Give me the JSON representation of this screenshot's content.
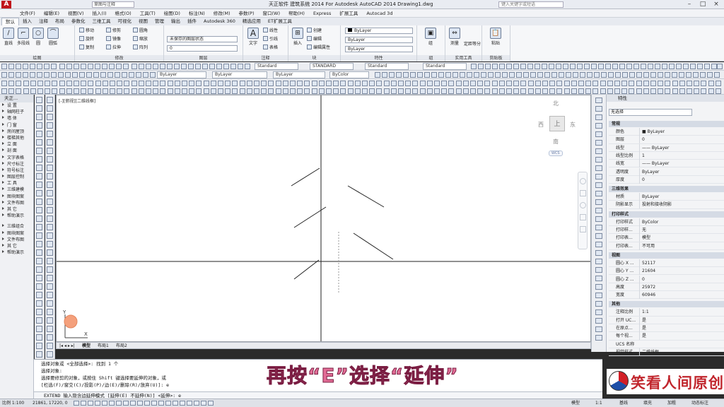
{
  "title_bar": {
    "workspace": "草图与注释",
    "title": "天正软件 建筑系统 2014  For Autodesk AutoCAD 2014    Drawing1.dwg",
    "search_placeholder": "键入关键字或短语"
  },
  "menu": [
    "文件(F)",
    "编辑(E)",
    "视图(V)",
    "插入(I)",
    "格式(O)",
    "工具(T)",
    "绘图(D)",
    "标注(N)",
    "修改(M)",
    "参数(P)",
    "窗口(W)",
    "帮助(H)",
    "Express",
    "扩展工具",
    "Autocad 3d"
  ],
  "ribbon_tabs": [
    "默认",
    "插入",
    "注释",
    "布局",
    "参数化",
    "三维工具",
    "可视化",
    "视图",
    "管理",
    "输出",
    "插件",
    "Autodesk 360",
    "精选应用",
    "ET扩展工具"
  ],
  "ribbon": {
    "draw_panel": {
      "label": "绘图",
      "tools": [
        "直线",
        "多段线",
        "圆",
        "圆弧"
      ]
    },
    "modify_panel": {
      "label": "修改",
      "tools": [
        "移动",
        "旋转",
        "修剪",
        "复制",
        "镜像",
        "圆角",
        "拉伸",
        "缩放",
        "阵列"
      ]
    },
    "annotation_panel": {
      "label": "注释",
      "text": "文字",
      "tools": [
        "线性",
        "引线",
        "表格"
      ]
    },
    "layers_panel": {
      "label": "图层",
      "dropdown": "未保存的图层状态",
      "tools": [
        "图层特性"
      ]
    },
    "block_panel": {
      "label": "块",
      "tools": [
        "插入",
        "创建",
        "编辑",
        "编辑属性"
      ]
    },
    "properties_panel": {
      "label": "特性",
      "color": "ByLayer",
      "linetype": "ByLayer",
      "lineweight": "ByLayer"
    },
    "groups_panel": {
      "label": "组",
      "tools": [
        "组"
      ]
    },
    "utilities_panel": {
      "label": "实用工具",
      "tools": [
        "测量",
        "定距等分"
      ]
    },
    "clipboard_panel": {
      "label": "剪贴板",
      "tools": [
        "粘贴"
      ]
    }
  },
  "toolbars": {
    "style1": "Standard",
    "style2": "STANDARD",
    "style3": "Standard",
    "style4": "Standard",
    "layer1": "ByLayer",
    "layer2": "ByLayer",
    "color": "ByColor",
    "layer_current": "0"
  },
  "left_panel": {
    "header": "天正...",
    "items": [
      "设  置",
      "轴网柱子",
      "墙  体",
      "门  窗",
      "房间屋顶",
      "楼梯其他",
      "立  面",
      "剖  面",
      "文字表格",
      "尺寸标注",
      "符号标注",
      "图层控制",
      "工  具",
      "三维建模",
      "图块图案",
      "文件布图",
      "其  它",
      "帮助演示"
    ],
    "items2": [
      "三维组合",
      "图块图案",
      "文件布图",
      "其  它",
      "帮助演示"
    ]
  },
  "viewport": {
    "label": "[-][俯视][二维线框]",
    "viewcube": {
      "n": "北",
      "s": "南",
      "e": "东",
      "w": "西",
      "top": "上",
      "wcs": "WCS"
    },
    "ucs_x": "X",
    "ucs_y": "Y"
  },
  "layout_tabs": [
    "模型",
    "布局1",
    "布局2"
  ],
  "command_line": {
    "lines": [
      "选择对象或 <全部选择>: 找到 1 个",
      "选择对象:",
      "选择要修剪的对象，或按住 Shift 键选择要延伸的对象，或",
      "[栏选(F)/窗交(C)/投影(P)/边(E)/删除(R)/放弃(U)]: e"
    ],
    "prompt": "EXTEND 输入隐含边延伸模式 [延伸(E) 不延伸(N)] <延伸>: e"
  },
  "subtitle": "再按“E”选择“延伸”",
  "properties_palette": {
    "header": "特性",
    "selection": "无选择",
    "sections": {
      "general": "常规",
      "3d": "三维效果",
      "plot": "打印样式",
      "view": "视图",
      "misc": "其他"
    },
    "general_rows": [
      {
        "k": "颜色",
        "v": "■ ByLayer"
      },
      {
        "k": "图层",
        "v": "0"
      },
      {
        "k": "线型",
        "v": "—— ByLayer"
      },
      {
        "k": "线型比例",
        "v": "1"
      },
      {
        "k": "线宽",
        "v": "—— ByLayer"
      },
      {
        "k": "透明度",
        "v": "ByLayer"
      },
      {
        "k": "厚度",
        "v": "0"
      }
    ],
    "3d_rows": [
      {
        "k": "材质",
        "v": "ByLayer"
      },
      {
        "k": "阴影显示",
        "v": "投射和接收阴影"
      }
    ],
    "plot_rows": [
      {
        "k": "打印样式",
        "v": "ByColor"
      },
      {
        "k": "打印样...",
        "v": "无"
      },
      {
        "k": "打印表...",
        "v": "模型"
      },
      {
        "k": "打印表...",
        "v": "不可用"
      }
    ],
    "view_rows": [
      {
        "k": "圆心 X ...",
        "v": "52117"
      },
      {
        "k": "圆心 Y ...",
        "v": "21604"
      },
      {
        "k": "圆心 Z ...",
        "v": "0"
      },
      {
        "k": "高度",
        "v": "25972"
      },
      {
        "k": "宽度",
        "v": "60946"
      }
    ],
    "misc_rows": [
      {
        "k": "注释比例",
        "v": "1:1"
      },
      {
        "k": "打开 UC...",
        "v": "是"
      },
      {
        "k": "在原点...",
        "v": "是"
      },
      {
        "k": "每个视...",
        "v": "是"
      },
      {
        "k": "UCS 名称",
        "v": ""
      },
      {
        "k": "视觉样式",
        "v": "二维线框"
      }
    ]
  },
  "status": {
    "scale": "比例 1:100",
    "coords": "21861, 17220, 0",
    "right_items": [
      "模型",
      "1:1",
      "基线",
      "填充",
      "加粗",
      "动态标注"
    ]
  },
  "watermark": "笑看人间原创",
  "colors": {
    "accent": "#c0151b",
    "subtitle": "#e26d96"
  }
}
